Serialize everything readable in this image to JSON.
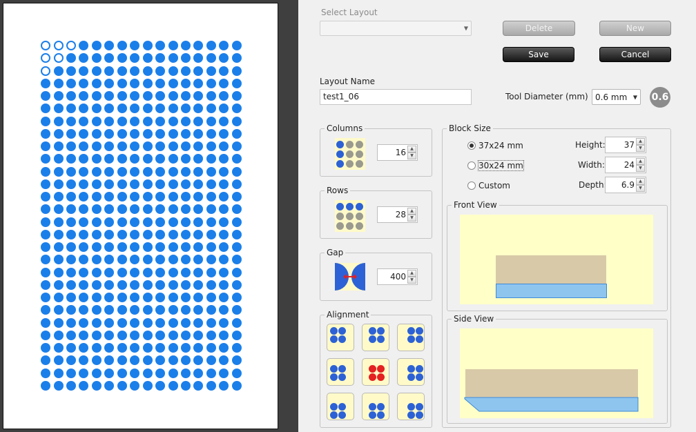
{
  "preview": {
    "columns": 16,
    "rows": 28,
    "empty_dots": [
      [
        0,
        0
      ],
      [
        0,
        1
      ],
      [
        0,
        2
      ],
      [
        1,
        0
      ],
      [
        1,
        1
      ],
      [
        2,
        0
      ]
    ],
    "dot_color": "#1b7fea"
  },
  "header": {
    "select_layout_label": "Select Layout",
    "select_layout_value": "",
    "delete_label": "Delete",
    "new_label": "New",
    "save_label": "Save",
    "cancel_label": "Cancel"
  },
  "layout_name": {
    "label": "Layout Name",
    "value": "test1_06"
  },
  "tool": {
    "label": "Tool Diameter (mm)",
    "value": "0.6 mm",
    "badge": "0.6"
  },
  "columns": {
    "title": "Columns",
    "value": "16"
  },
  "rows": {
    "title": "Rows",
    "value": "28"
  },
  "gap": {
    "title": "Gap",
    "value": "400"
  },
  "alignment": {
    "title": "Alignment",
    "selected": "center"
  },
  "block_size": {
    "title": "Block Size",
    "options": [
      "37x24 mm",
      "30x24 mm",
      "Custom"
    ],
    "selected": "37x24 mm",
    "height_label": "Height:",
    "height_value": "37",
    "width_label": "Width:",
    "width_value": "24",
    "depth_label": "Depth:",
    "depth_value": "6.9"
  },
  "front_view": {
    "title": "Front View"
  },
  "side_view": {
    "title": "Side View"
  },
  "colors": {
    "accent_blue": "#1b7fea",
    "thumb_yellow": "#fffac8",
    "block_tan": "#d8c9a8",
    "base_blue": "#8ec5ef",
    "selected_red": "#e42020"
  }
}
